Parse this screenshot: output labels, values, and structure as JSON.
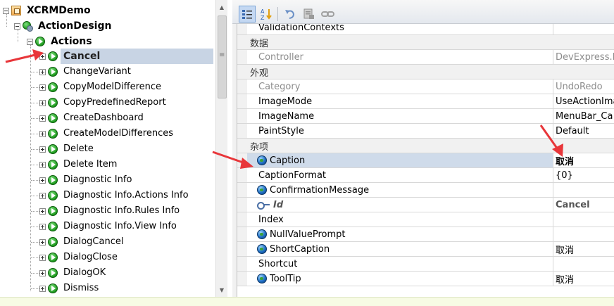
{
  "tree": {
    "root": "XCRMDemo",
    "design": "ActionDesign",
    "actions": "Actions",
    "selected": "Cancel",
    "items": [
      "ChangeVariant",
      "CopyModelDifference",
      "CopyPredefinedReport",
      "CreateDashboard",
      "CreateModelDifferences",
      "Delete",
      "Delete Item",
      "Diagnostic Info",
      "Diagnostic Info.Actions Info",
      "Diagnostic Info.Rules Info",
      "Diagnostic Info.View Info",
      "DialogCancel",
      "DialogClose",
      "DialogOK",
      "Dismiss"
    ]
  },
  "toolbar": {
    "buttons": [
      "categorized-icon",
      "alphabetical-icon",
      "undo-icon",
      "reset-icon",
      "link-icon"
    ]
  },
  "grid": {
    "top_row": {
      "name": "ValidationContexts",
      "value": ""
    },
    "cat_data": "数据",
    "controller": {
      "name": "Controller",
      "value": "DevExpress.E"
    },
    "cat_appearance": "外观",
    "category": {
      "name": "Category",
      "value": "UndoRedo"
    },
    "image_mode": {
      "name": "ImageMode",
      "value": "UseActionIma"
    },
    "image_name": {
      "name": "ImageName",
      "value": "MenuBar_Ca"
    },
    "paint_style": {
      "name": "PaintStyle",
      "value": "Default"
    },
    "cat_misc": "杂项",
    "caption": {
      "name": "Caption",
      "value": "取消"
    },
    "caption_format": {
      "name": "CaptionFormat",
      "value": "{0}"
    },
    "confirmation": {
      "name": "ConfirmationMessage",
      "value": ""
    },
    "id": {
      "name": "Id",
      "value": "Cancel"
    },
    "index": {
      "name": "Index",
      "value": ""
    },
    "null_value": {
      "name": "NullValuePrompt",
      "value": ""
    },
    "short_caption": {
      "name": "ShortCaption",
      "value": "取消"
    },
    "shortcut": {
      "name": "Shortcut",
      "value": ""
    },
    "tooltip": {
      "name": "ToolTip",
      "value": "取消"
    }
  },
  "colors": {
    "selection": "#c8d4e4",
    "arrow": "#e8363a",
    "status_bar": "#f7fbe4"
  }
}
